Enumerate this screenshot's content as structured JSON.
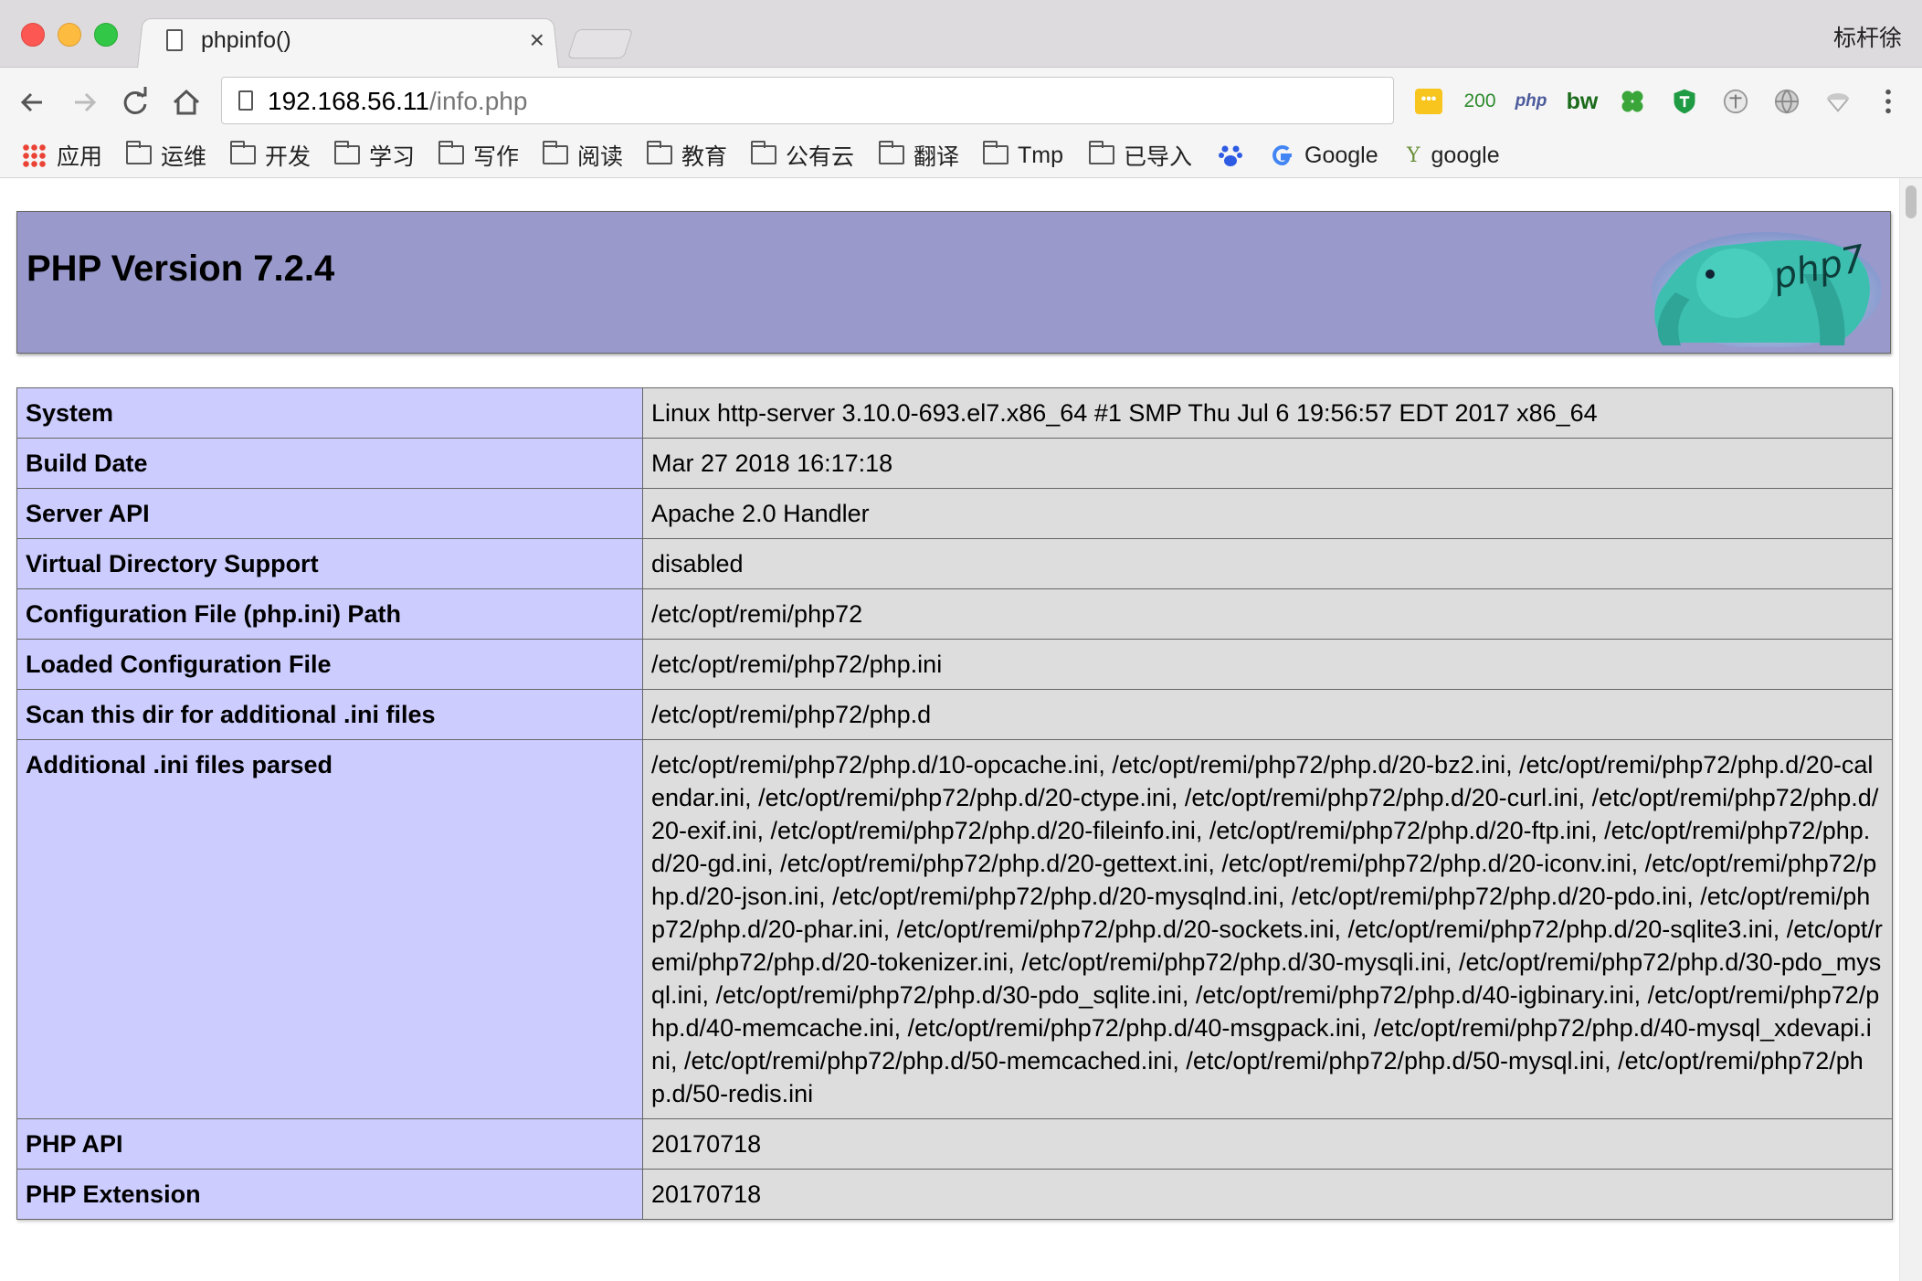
{
  "browser": {
    "tab_title": "phpinfo()",
    "user_name": "标杆徐",
    "url_host": "192.168.56.11",
    "url_path": "/info.php",
    "extensions": {
      "counter": "200",
      "php": "php",
      "bw": "bw"
    },
    "bookmarks": [
      {
        "label": "应用"
      },
      {
        "label": "运维"
      },
      {
        "label": "开发"
      },
      {
        "label": "学习"
      },
      {
        "label": "写作"
      },
      {
        "label": "阅读"
      },
      {
        "label": "教育"
      },
      {
        "label": "公有云"
      },
      {
        "label": "翻译"
      },
      {
        "label": "Tmp"
      },
      {
        "label": "已导入"
      },
      {
        "label": "Google"
      },
      {
        "label": "google"
      }
    ]
  },
  "page": {
    "version_title": "PHP Version 7.2.4",
    "logo_text": "php7",
    "rows": [
      {
        "key": "System",
        "value": "Linux http-server 3.10.0-693.el7.x86_64 #1 SMP Thu Jul 6 19:56:57 EDT 2017 x86_64"
      },
      {
        "key": "Build Date",
        "value": "Mar 27 2018 16:17:18"
      },
      {
        "key": "Server API",
        "value": "Apache 2.0 Handler"
      },
      {
        "key": "Virtual Directory Support",
        "value": "disabled"
      },
      {
        "key": "Configuration File (php.ini) Path",
        "value": "/etc/opt/remi/php72"
      },
      {
        "key": "Loaded Configuration File",
        "value": "/etc/opt/remi/php72/php.ini"
      },
      {
        "key": "Scan this dir for additional .ini files",
        "value": "/etc/opt/remi/php72/php.d"
      },
      {
        "key": "Additional .ini files parsed",
        "value": "/etc/opt/remi/php72/php.d/10-opcache.ini, /etc/opt/remi/php72/php.d/20-bz2.ini, /etc/opt/remi/php72/php.d/20-calendar.ini, /etc/opt/remi/php72/php.d/20-ctype.ini, /etc/opt/remi/php72/php.d/20-curl.ini, /etc/opt/remi/php72/php.d/20-exif.ini, /etc/opt/remi/php72/php.d/20-fileinfo.ini, /etc/opt/remi/php72/php.d/20-ftp.ini, /etc/opt/remi/php72/php.d/20-gd.ini, /etc/opt/remi/php72/php.d/20-gettext.ini, /etc/opt/remi/php72/php.d/20-iconv.ini, /etc/opt/remi/php72/php.d/20-json.ini, /etc/opt/remi/php72/php.d/20-mysqlnd.ini, /etc/opt/remi/php72/php.d/20-pdo.ini, /etc/opt/remi/php72/php.d/20-phar.ini, /etc/opt/remi/php72/php.d/20-sockets.ini, /etc/opt/remi/php72/php.d/20-sqlite3.ini, /etc/opt/remi/php72/php.d/20-tokenizer.ini, /etc/opt/remi/php72/php.d/30-mysqli.ini, /etc/opt/remi/php72/php.d/30-pdo_mysql.ini, /etc/opt/remi/php72/php.d/30-pdo_sqlite.ini, /etc/opt/remi/php72/php.d/40-igbinary.ini, /etc/opt/remi/php72/php.d/40-memcache.ini, /etc/opt/remi/php72/php.d/40-msgpack.ini, /etc/opt/remi/php72/php.d/40-mysql_xdevapi.ini, /etc/opt/remi/php72/php.d/50-memcached.ini, /etc/opt/remi/php72/php.d/50-mysql.ini, /etc/opt/remi/php72/php.d/50-redis.ini"
      },
      {
        "key": "PHP API",
        "value": "20170718"
      },
      {
        "key": "PHP Extension",
        "value": "20170718"
      }
    ]
  },
  "colors": {
    "header_bg": "#9999cc",
    "key_cell_bg": "#ccccff",
    "value_cell_bg": "#dddddd"
  }
}
